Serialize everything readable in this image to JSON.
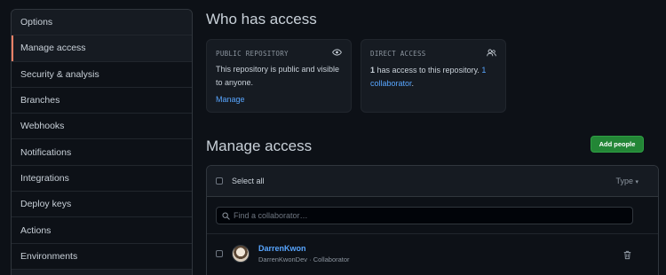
{
  "sidebar": {
    "items": [
      {
        "label": "Options"
      },
      {
        "label": "Manage access"
      },
      {
        "label": "Security & analysis"
      },
      {
        "label": "Branches"
      },
      {
        "label": "Webhooks"
      },
      {
        "label": "Notifications"
      },
      {
        "label": "Integrations"
      },
      {
        "label": "Deploy keys"
      },
      {
        "label": "Actions"
      },
      {
        "label": "Environments"
      }
    ],
    "active_index": 1
  },
  "who": {
    "title": "Who has access",
    "public_card": {
      "heading": "PUBLIC REPOSITORY",
      "icon": "eye-icon",
      "text": "This repository is public and visible to anyone.",
      "link": "Manage"
    },
    "direct_card": {
      "heading": "DIRECT ACCESS",
      "icon": "people-icon",
      "count": "1",
      "text_mid": " has access to this repository. ",
      "link": "1 collaborator",
      "text_end": "."
    }
  },
  "manage": {
    "title": "Manage access",
    "add_button": "Add people",
    "select_all": "Select all",
    "type_label": "Type",
    "search_placeholder": "Find a collaborator…",
    "members": [
      {
        "name": "DarrenKwon",
        "username": "DarrenKwonDev",
        "role": "Collaborator"
      }
    ]
  },
  "colors": {
    "accent": "#58a6ff",
    "active_marker": "#f78166",
    "button_green": "#238636"
  }
}
